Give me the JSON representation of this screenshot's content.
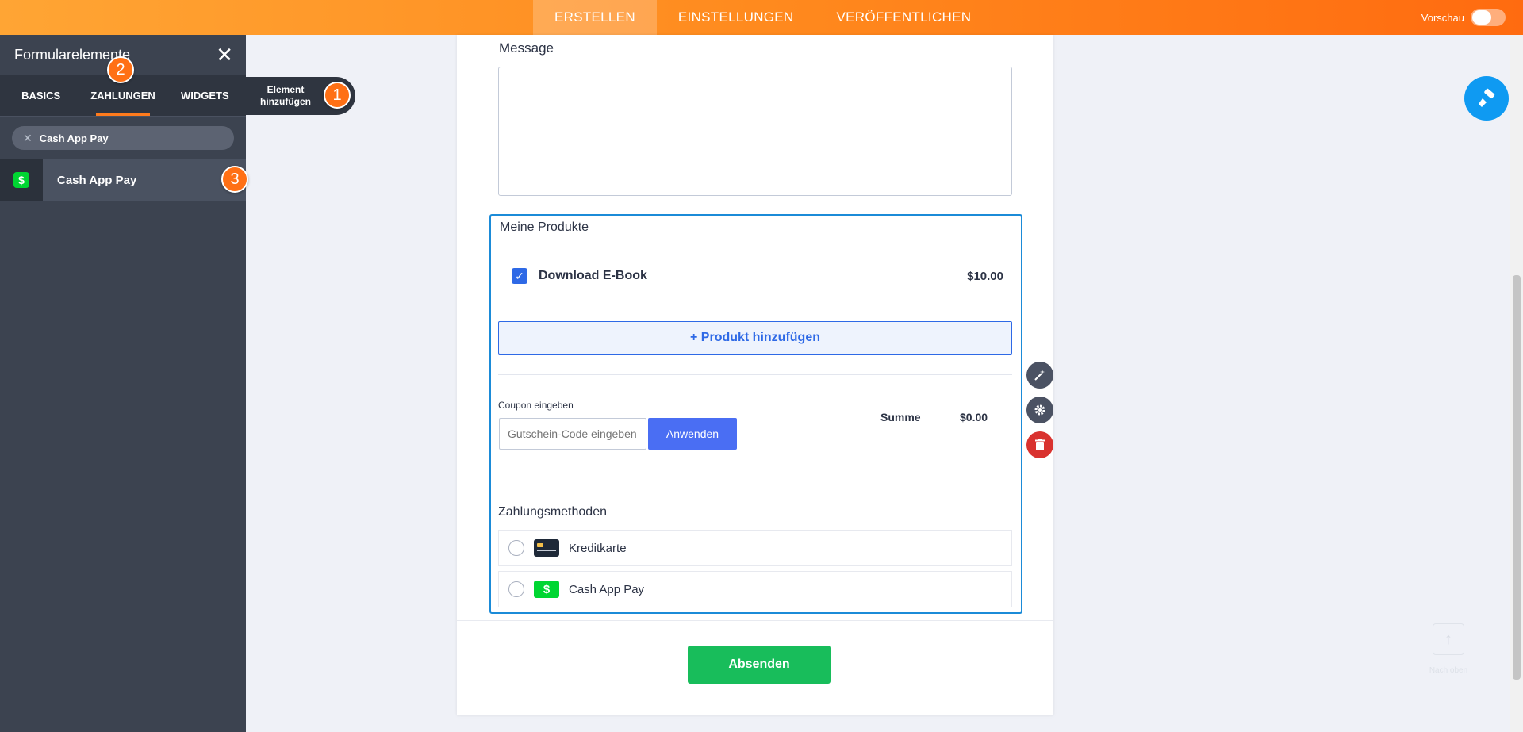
{
  "topbar": {
    "tabs": [
      "ERSTELLEN",
      "EINSTELLUNGEN",
      "VERÖFFENTLICHEN"
    ],
    "active_tab": "ERSTELLEN",
    "preview_label": "Vorschau"
  },
  "left_panel": {
    "title": "Formularelemente",
    "tabs": [
      "BASICS",
      "ZAHLUNGEN",
      "WIDGETS"
    ],
    "active_tab": "ZAHLUNGEN",
    "search_value": "Cash App Pay",
    "results": [
      {
        "label": "Cash App Pay",
        "icon": "cash-app-icon"
      }
    ]
  },
  "tooltip": {
    "line1": "Element",
    "line2": "hinzufügen"
  },
  "badges": [
    "1",
    "2",
    "3"
  ],
  "form": {
    "message_label": "Message",
    "products": {
      "title": "Meine Produkte",
      "items": [
        {
          "name": "Download E-Book",
          "price": "$10.00",
          "checked": true
        }
      ],
      "add_product_label": "+ Produkt hinzufügen",
      "coupon_label": "Coupon eingeben",
      "coupon_placeholder": "Gutschein-Code eingeben",
      "apply_label": "Anwenden",
      "sum_label": "Summe",
      "sum_value": "$0.00"
    },
    "payment": {
      "title": "Zahlungsmethoden",
      "methods": [
        {
          "label": "Kreditkarte",
          "icon": "credit-card-icon"
        },
        {
          "label": "Cash App Pay",
          "icon": "cash-app-icon"
        }
      ]
    },
    "submit_label": "Absenden"
  },
  "scroll_top_label": "Nach oben",
  "colors": {
    "accent": "#ff7b1c",
    "primary": "#2e69e6",
    "submit": "#18bd5b",
    "selection": "#1b8bd8"
  }
}
